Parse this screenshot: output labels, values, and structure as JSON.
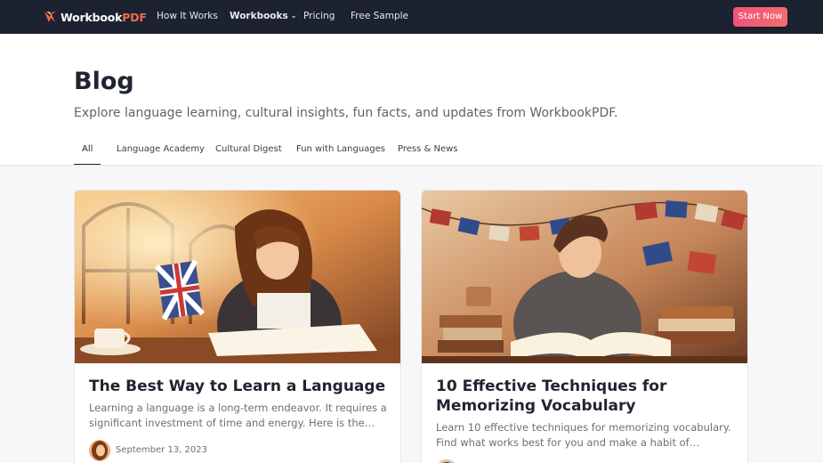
{
  "nav": {
    "logo_main": "Workbook",
    "logo_accent": "PDF",
    "links": [
      "How It Works",
      "Workbooks",
      "Pricing",
      "Free Sample"
    ],
    "start_label": "Start Now"
  },
  "header": {
    "title": "Blog",
    "subtitle": "Explore language learning, cultural insights, fun facts, and updates from WorkbookPDF."
  },
  "tabs": [
    "All",
    "Language Academy",
    "Cultural Digest",
    "Fun with Languages",
    "Press & News"
  ],
  "active_tab": "All",
  "posts": [
    {
      "title": "The Best Way to Learn a Language",
      "excerpt": "Learning a language is a long-term endeavor. It requires a significant investment of time and energy. Here is the best way to learn a...",
      "date": "September 13, 2023"
    },
    {
      "title": "10 Effective Techniques for Memorizing Vocabulary",
      "excerpt": "Learn 10 effective techniques for memorizing vocabulary. Find what works best for you and make a habit of regularly reviewing and using...",
      "date": ""
    }
  ],
  "colors": {
    "nav_bg": "#1d2231",
    "accent": "#f0527a",
    "logo_accent": "#f06a4c"
  }
}
